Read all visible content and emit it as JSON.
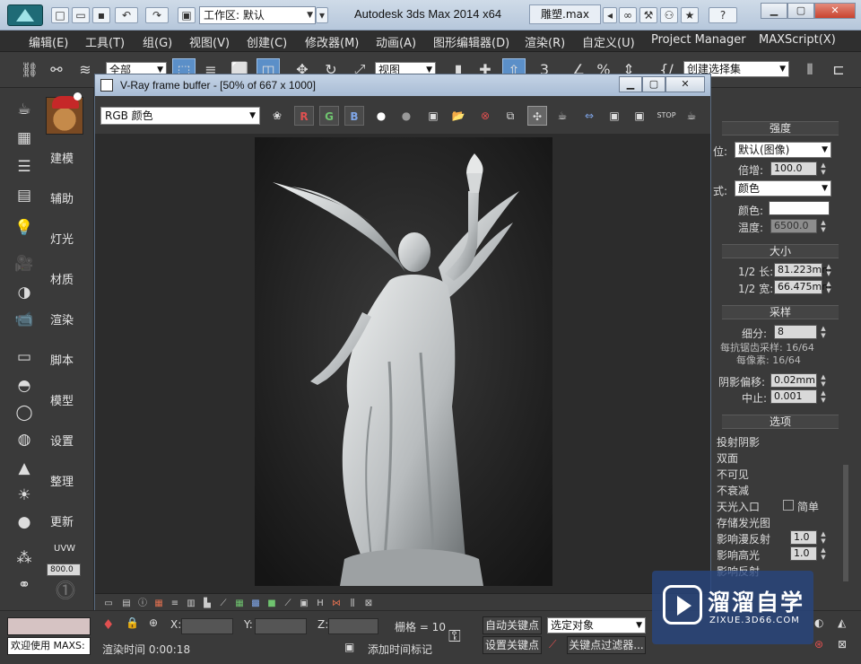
{
  "titlebar": {
    "workspace": "工作区: 默认",
    "title": "Autodesk 3ds Max  2014 x64",
    "file": "雕塑.max",
    "help": "?"
  },
  "menu": [
    "编辑(E)",
    "工具(T)",
    "组(G)",
    "视图(V)",
    "创建(C)",
    "修改器(M)",
    "动画(A)",
    "图形编辑器(D)",
    "渲染(R)",
    "自定义(U)",
    "Project Manager",
    "MAXScript(X)"
  ],
  "toolbar": {
    "filter": "全部",
    "refcoord": "视图",
    "snap_number": "3",
    "selection_set": "创建选择集"
  },
  "left_panel": {
    "buttons": [
      "建模",
      "辅助",
      "灯光",
      "材质",
      "渲染",
      "脚本",
      "模型",
      "设置",
      "整理",
      "更新",
      "UVW"
    ],
    "value": "800.0"
  },
  "vfb": {
    "title": "V-Ray frame buffer - [50% of 667 x 1000]",
    "channel": "RGB 颜色",
    "r": "R",
    "g": "G",
    "b": "B"
  },
  "right_panel": {
    "intensity_header": "强度",
    "units_label": "位:",
    "units_value": "默认(图像)",
    "multiplier_label": "倍增:",
    "multiplier_value": "100.0",
    "mode_label": "式:",
    "mode_value": "颜色",
    "color_label": "颜色:",
    "temp_label": "温度:",
    "temp_value": "6500.0",
    "size_header": "大小",
    "half_length_label": "1/2 长:",
    "half_length_value": "81.223mm",
    "half_width_label": "1/2 宽:",
    "half_width_value": "66.475mm",
    "sampling_header": "采样",
    "subdivs_label": "细分:",
    "subdivs_value": "8",
    "aa_samples": "每抗锯齿采样: 16/64",
    "per_pixel": "每像素: 16/64",
    "shadow_bias_label": "阴影偏移:",
    "shadow_bias_value": "0.02mm",
    "cutoff_label": "中止:",
    "cutoff_value": "0.001",
    "options_header": "选项",
    "options": [
      "投射阴影",
      "双面",
      "不可见",
      "不衰减",
      "天光入口",
      "存储发光图",
      "影响漫反射",
      "影响高光",
      "影响反射"
    ],
    "simple_label": "简单",
    "diffuse_value": "1.0",
    "specular_value": "1.0"
  },
  "status": {
    "welcome": "欢迎使用 MAXS:",
    "x_label": "X:",
    "y_label": "Y:",
    "z_label": "Z:",
    "grid": "栅格 = 10",
    "autokey": "自动关键点",
    "selection": "选定对象",
    "setkey": "设置关键点",
    "key_filter": "关键点过滤器...",
    "render_time": "渲染时间  0:00:18",
    "add_time_tag": "添加时间标记"
  },
  "watermark": {
    "cn": "溜溜自学",
    "en": "ZIXUE.3D66.COM"
  }
}
